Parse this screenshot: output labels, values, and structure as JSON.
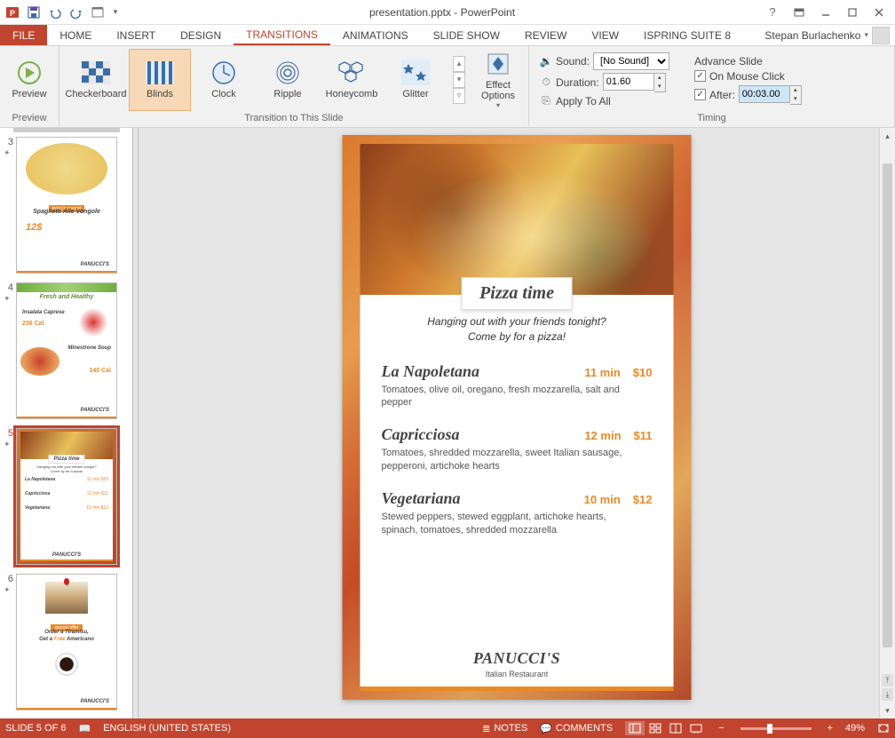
{
  "window": {
    "title": "presentation.pptx - PowerPoint"
  },
  "user": {
    "name": "Stepan Burlachenko"
  },
  "tabs": {
    "file": "FILE",
    "home": "HOME",
    "insert": "INSERT",
    "design": "DESIGN",
    "transitions": "TRANSITIONS",
    "animations": "ANIMATIONS",
    "slideshow": "SLIDE SHOW",
    "review": "REVIEW",
    "view": "VIEW",
    "ispring": "ISPRING SUITE 8"
  },
  "ribbon": {
    "preview": {
      "label": "Preview",
      "group": "Preview"
    },
    "gallery": {
      "group": "Transition to This Slide",
      "items": {
        "checkerboard": "Checkerboard",
        "blinds": "Blinds",
        "clock": "Clock",
        "ripple": "Ripple",
        "honeycomb": "Honeycomb",
        "glitter": "Glitter"
      },
      "effect_options": "Effect Options"
    },
    "timing": {
      "group": "Timing",
      "sound_label": "Sound:",
      "sound_value": "[No Sound]",
      "duration_label": "Duration:",
      "duration_value": "01.60",
      "apply_all": "Apply To All",
      "advance_title": "Advance Slide",
      "on_click": "On Mouse Click",
      "after_label": "After:",
      "after_value": "00:03.00"
    }
  },
  "thumbs": {
    "n3": "3",
    "n4": "4",
    "n5": "5",
    "n6": "6",
    "t3_title": "Spaghetti Alle Vongole",
    "t3_price": "12$",
    "t4_title": "Fresh and Healthy",
    "t4_a": "Insalata Caprese",
    "t4_a_cal": "236 Cal",
    "t4_b": "Minestrone Soup",
    "t4_b_cal": "140 Cal",
    "t6_line1": "Order a Tiramisu,",
    "t6_line2": "Get a Free Americano",
    "brand": "PANUCCI'S"
  },
  "slide": {
    "badge": "Pizza time",
    "tag1": "Hanging out with your friends tonight?",
    "tag2": "Come by for a pizza!",
    "items": [
      {
        "name": "La Napoletana",
        "time": "11 min",
        "price": "$10",
        "desc": "Tomatoes, olive oil, oregano, fresh mozzarella, salt and pepper"
      },
      {
        "name": "Capricciosa",
        "time": "12 min",
        "price": "$11",
        "desc": "Tomatoes, shredded mozzarella, sweet Italian sausage, pepperoni, artichoke hearts"
      },
      {
        "name": "Vegetariana",
        "time": "10 min",
        "price": "$12",
        "desc": "Stewed peppers, stewed eggplant, artichoke hearts, spinach, tomatoes, shredded mozzarella"
      }
    ],
    "brand": "PANUCCI'S",
    "brand_sub": "Italian Restaurant"
  },
  "status": {
    "slide": "SLIDE 5 OF 6",
    "lang": "ENGLISH (UNITED STATES)",
    "notes": "NOTES",
    "comments": "COMMENTS",
    "zoom": "49%"
  }
}
